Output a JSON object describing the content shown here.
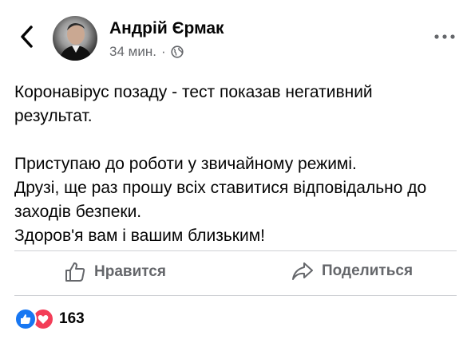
{
  "post": {
    "author": "Андрій Єрмак",
    "time": "34 мин.",
    "separator": "·",
    "privacy_icon": "globe-icon",
    "lines": [
      "Коронавірус позаду - тест показав негативний",
      "результат.",
      "Приступаю до роботи у звичайному режимі.",
      "Друзі, ще раз прошу всіх ставитися відповідально до",
      "заходів безпеки.",
      "Здоров'я вам і вашим близьким!"
    ]
  },
  "actions": {
    "like_label": "Нравится",
    "share_label": "Поделиться"
  },
  "reactions": {
    "count": "163"
  },
  "colors": {
    "text": "#050505",
    "secondary": "#65676b",
    "divider": "#ced0d4",
    "like_blue": "#1877f2",
    "love_red": "#f33e58"
  }
}
